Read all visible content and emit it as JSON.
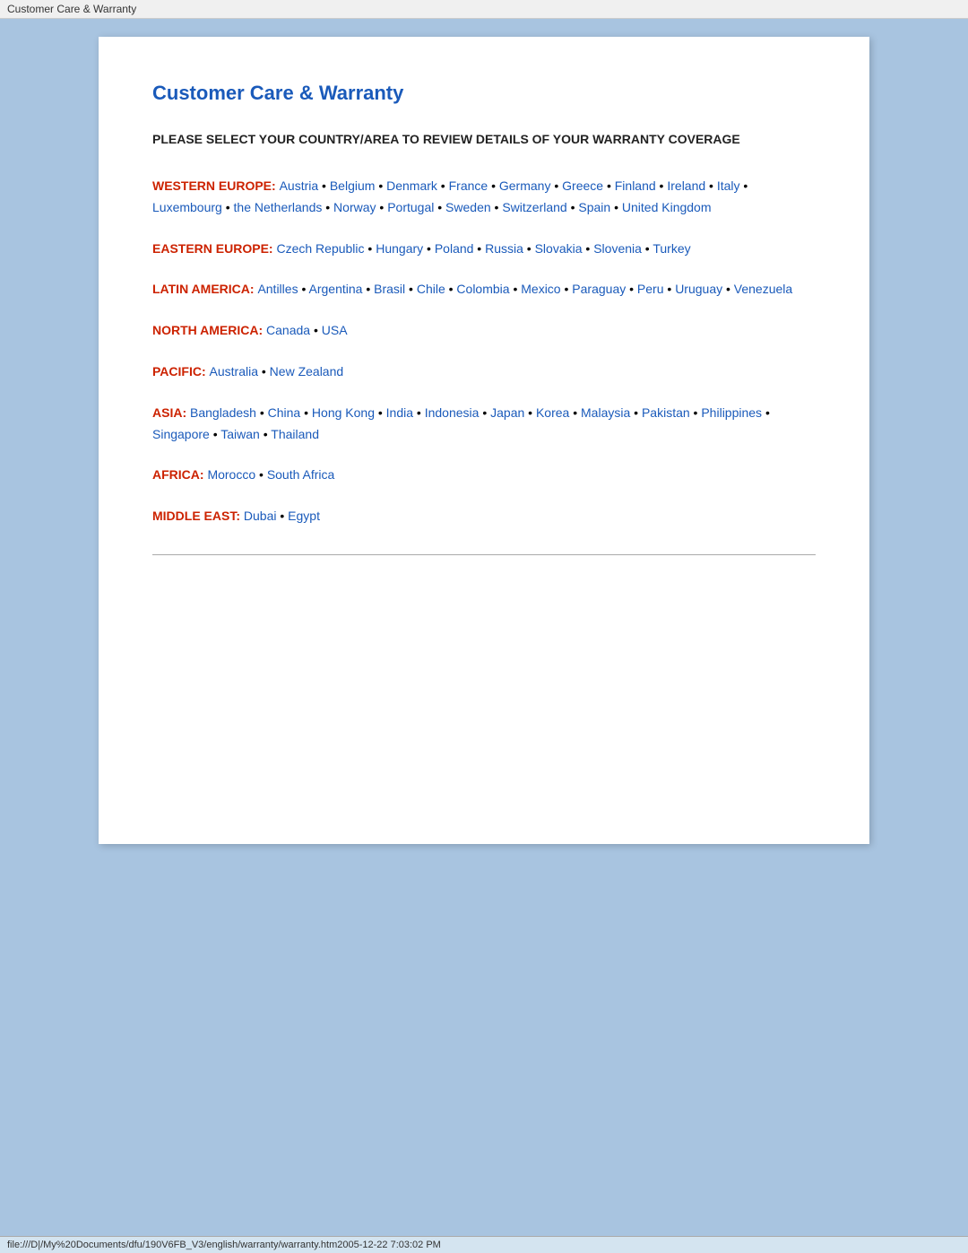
{
  "titleBar": {
    "label": "Customer Care & Warranty"
  },
  "page": {
    "title": "Customer Care & Warranty",
    "subtitle": "PLEASE SELECT YOUR COUNTRY/AREA TO REVIEW DETAILS OF YOUR WARRANTY COVERAGE",
    "regions": [
      {
        "id": "western-europe",
        "label": "WESTERN EUROPE:",
        "countries": [
          "Austria",
          "Belgium",
          "Denmark",
          "France",
          "Germany",
          "Greece",
          "Finland",
          "Ireland",
          "Italy",
          "Luxembourg",
          "the Netherlands",
          "Norway",
          "Portugal",
          "Sweden",
          "Switzerland",
          "Spain",
          "United Kingdom"
        ]
      },
      {
        "id": "eastern-europe",
        "label": "EASTERN EUROPE:",
        "countries": [
          "Czech Republic",
          "Hungary",
          "Poland",
          "Russia",
          "Slovakia",
          "Slovenia",
          "Turkey"
        ]
      },
      {
        "id": "latin-america",
        "label": "LATIN AMERICA:",
        "countries": [
          "Antilles",
          "Argentina",
          "Brasil",
          "Chile",
          "Colombia",
          "Mexico",
          "Paraguay",
          "Peru",
          "Uruguay",
          "Venezuela"
        ]
      },
      {
        "id": "north-america",
        "label": "NORTH AMERICA:",
        "countries": [
          "Canada",
          "USA"
        ]
      },
      {
        "id": "pacific",
        "label": "PACIFIC:",
        "countries": [
          "Australia",
          "New Zealand"
        ]
      },
      {
        "id": "asia",
        "label": "ASIA:",
        "countries": [
          "Bangladesh",
          "China",
          "Hong Kong",
          "India",
          "Indonesia",
          "Japan",
          "Korea",
          "Malaysia",
          "Pakistan",
          "Philippines",
          "Singapore",
          "Taiwan",
          "Thailand"
        ]
      },
      {
        "id": "africa",
        "label": "AFRICA:",
        "countries": [
          "Morocco",
          "South Africa"
        ]
      },
      {
        "id": "middle-east",
        "label": "MIDDLE EAST:",
        "countries": [
          "Dubai",
          "Egypt"
        ]
      }
    ]
  },
  "statusBar": {
    "text": "file:///D|/My%20Documents/dfu/190V6FB_V3/english/warranty/warranty.htm2005-12-22  7:03:02 PM"
  }
}
